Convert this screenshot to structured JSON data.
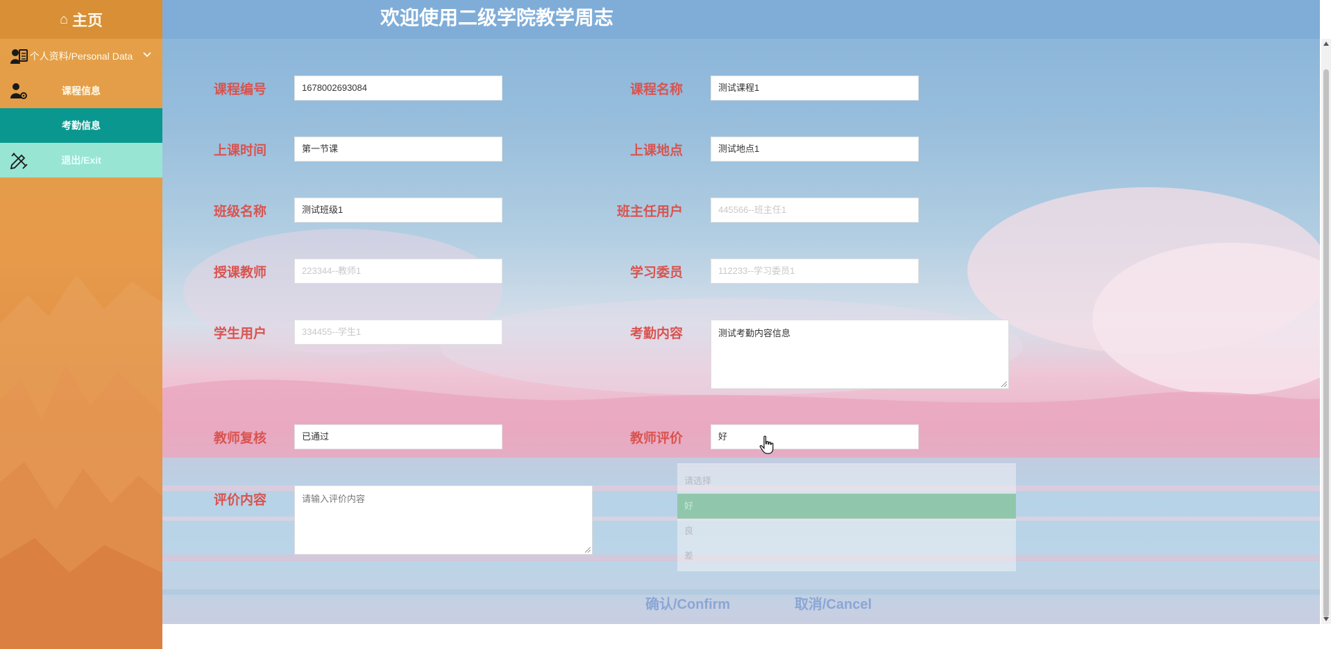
{
  "sidebar": {
    "home_label": "主页",
    "items": [
      {
        "label": "个人资料/Personal Data",
        "icon": "user-card-icon"
      },
      {
        "label": "课程信息",
        "icon": "user-gear-icon"
      },
      {
        "label": "考勤信息"
      },
      {
        "label": "退出/Exit",
        "icon": "pencil-ruler-icon"
      }
    ]
  },
  "header": {
    "title": "欢迎使用二级学院教学周志"
  },
  "form": {
    "course_no": {
      "label": "课程编号",
      "value": "1678002693084"
    },
    "course_name": {
      "label": "课程名称",
      "value": "测试课程1"
    },
    "class_time": {
      "label": "上课时间",
      "value": "第一节课"
    },
    "class_place": {
      "label": "上课地点",
      "value": "测试地点1"
    },
    "class_name": {
      "label": "班级名称",
      "value": "测试班级1"
    },
    "head_teacher": {
      "label": "班主任用户",
      "placeholder": "445566--班主任1"
    },
    "teacher": {
      "label": "授课教师",
      "placeholder": "223344--教师1"
    },
    "study_committee": {
      "label": "学习委员",
      "placeholder": "112233--学习委员1"
    },
    "student": {
      "label": "学生用户",
      "placeholder": "334455--学生1"
    },
    "attendance": {
      "label": "考勤内容",
      "value": "测试考勤内容信息"
    },
    "teacher_review": {
      "label": "教师复核",
      "value": "已通过"
    },
    "teacher_rating": {
      "label": "教师评价",
      "value": "好",
      "options": [
        "请选择",
        "好",
        "良",
        "差"
      ],
      "selected_index": 1
    },
    "comment": {
      "label": "评价内容",
      "placeholder": "请输入评价内容"
    }
  },
  "buttons": {
    "confirm": "确认/Confirm",
    "cancel": "取消/Cancel"
  },
  "colors": {
    "label": "#d9534f",
    "active_nav": "#0a978f",
    "topbar": "#7eadd8"
  }
}
